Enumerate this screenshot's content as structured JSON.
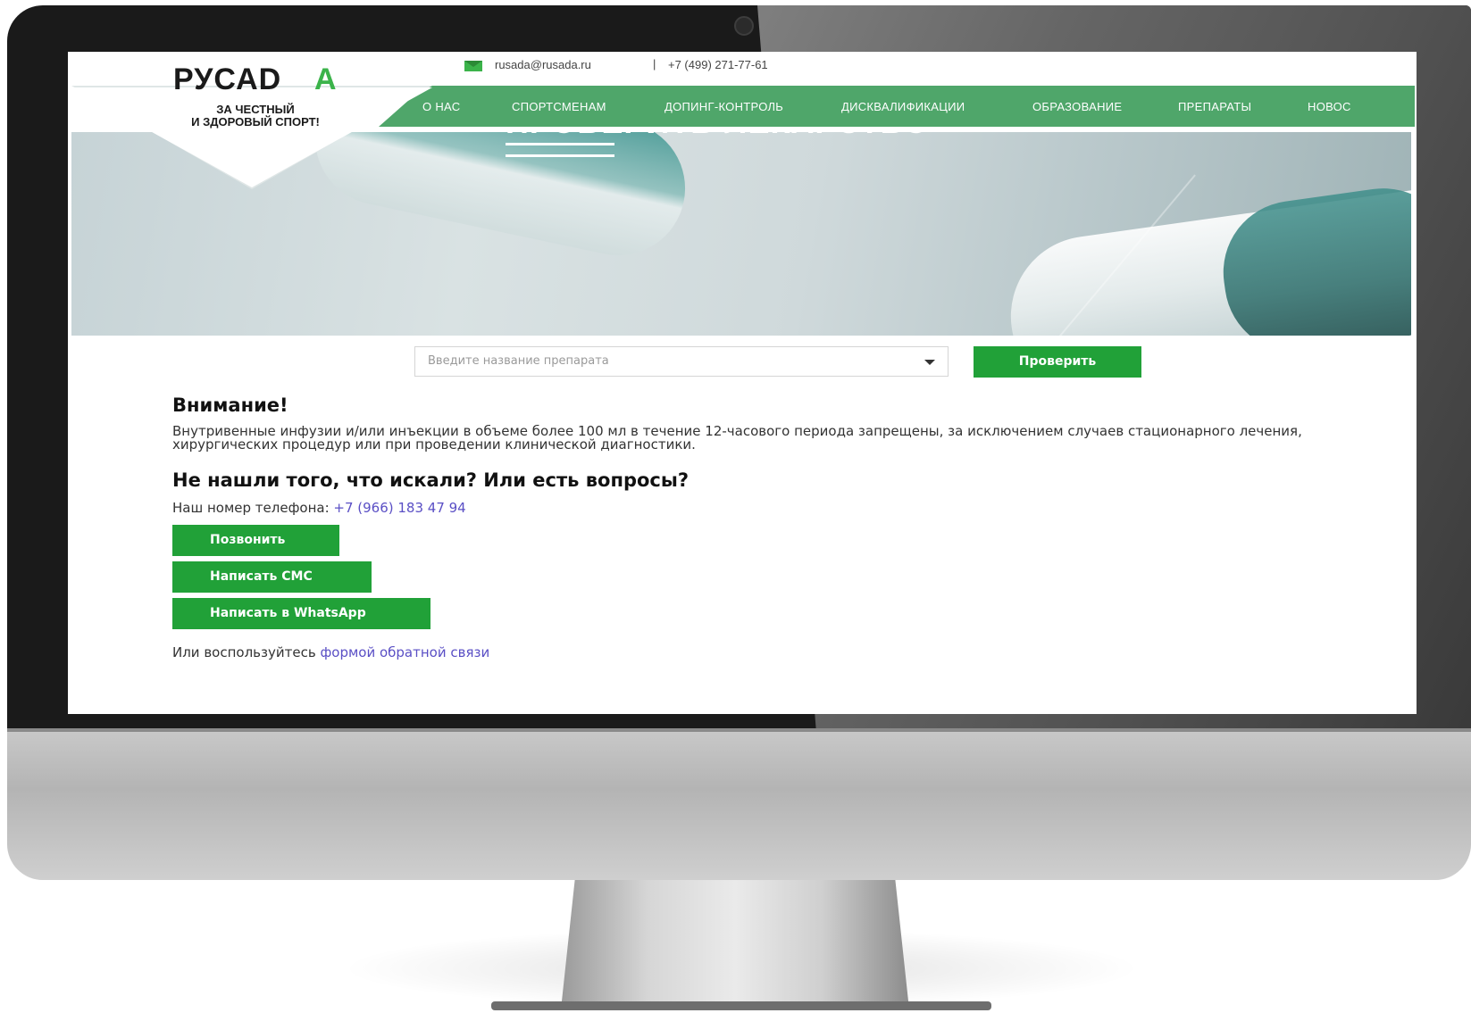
{
  "header": {
    "logo_text": "РУСАD",
    "logo_letter": "A",
    "tagline_line1": "ЗА ЧЕСТНЫЙ",
    "tagline_line2": "И ЗДОРОВЫЙ СПОРТ!",
    "email": "rusada@rusada.ru",
    "separator": "|",
    "phone": "+7 (499) 271-77-61"
  },
  "nav": {
    "items": [
      {
        "label": "О НАС"
      },
      {
        "label": "СПОРТСМЕНАМ"
      },
      {
        "label": "ДОПИНГ-КОНТРОЛЬ"
      },
      {
        "label": "ДИСКВАЛИФИКАЦИИ"
      },
      {
        "label": "ОБРАЗОВАНИЕ"
      },
      {
        "label": "ПРЕПАРАТЫ"
      },
      {
        "label": "НОВОС"
      }
    ]
  },
  "hero": {
    "title": "ПРОВЕРИТЬ ЛЕКАРСТВО"
  },
  "search": {
    "placeholder": "Введите название препарата",
    "button_label": "Проверить"
  },
  "content": {
    "attention_title": "Внимание!",
    "attention_text": "Внутривенные инфузии и/или инъекции в объеме более 100 мл в течение 12-часового периода запрещены, за исключением случаев стационарного лечения, хирургических процедур или при проведении клинической диагностики.",
    "question_title": "Не нашли того, что искали? Или есть вопросы?",
    "phone_label": "Наш номер телефона: ",
    "phone_value": "+7 (966) 183 47 94",
    "buttons": {
      "call": "Позвонить",
      "sms": "Написать СМС",
      "whatsapp": "Написать в WhatsApp"
    },
    "feedback_prefix": "Или воспользуйтесь ",
    "feedback_link": "формой обратной связи"
  },
  "colors": {
    "accent_green": "#21a138",
    "nav_green": "#4fa66a",
    "link_purple": "#5a4fc5"
  },
  "icons": {
    "email": "envelope-icon",
    "dropdown": "chevron-down-icon"
  }
}
